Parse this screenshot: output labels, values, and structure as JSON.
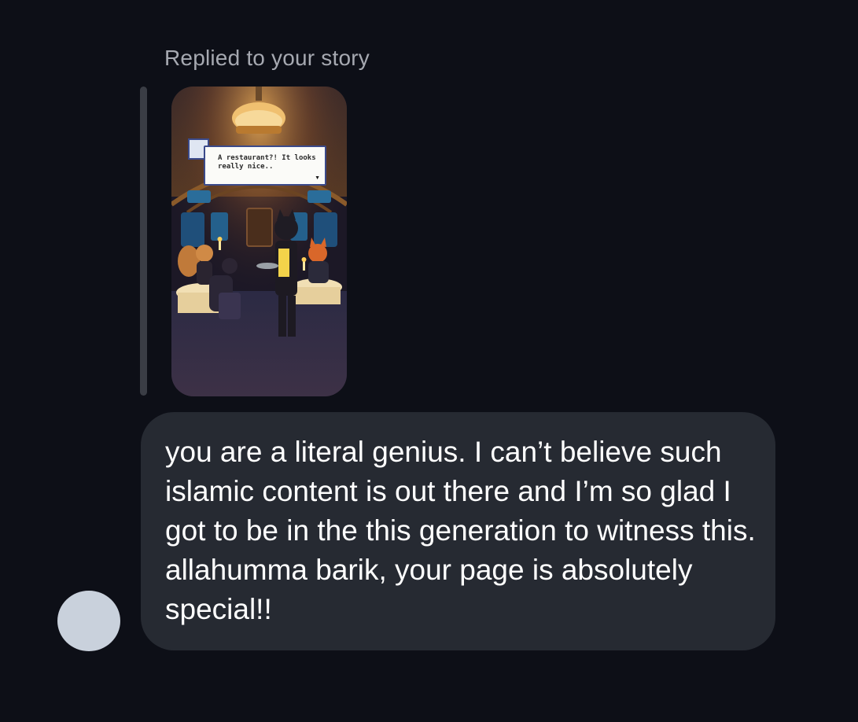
{
  "story_reply": {
    "label": "Replied to your story",
    "thumbnail": {
      "dialog_text": "A restaurant?! It looks really nice..",
      "dialog_arrow": "▼"
    }
  },
  "message": {
    "text": "you are a literal genius. I can’t believe such islamic content is out there and I’m so glad I got to be in the this generation to witness this. allahumma barik, your page is absolutely special!!"
  },
  "colors": {
    "background": "#0d0f17",
    "bubble": "#262a32",
    "avatar_placeholder": "#c9d1dc",
    "label_text": "#a6a9b1"
  }
}
